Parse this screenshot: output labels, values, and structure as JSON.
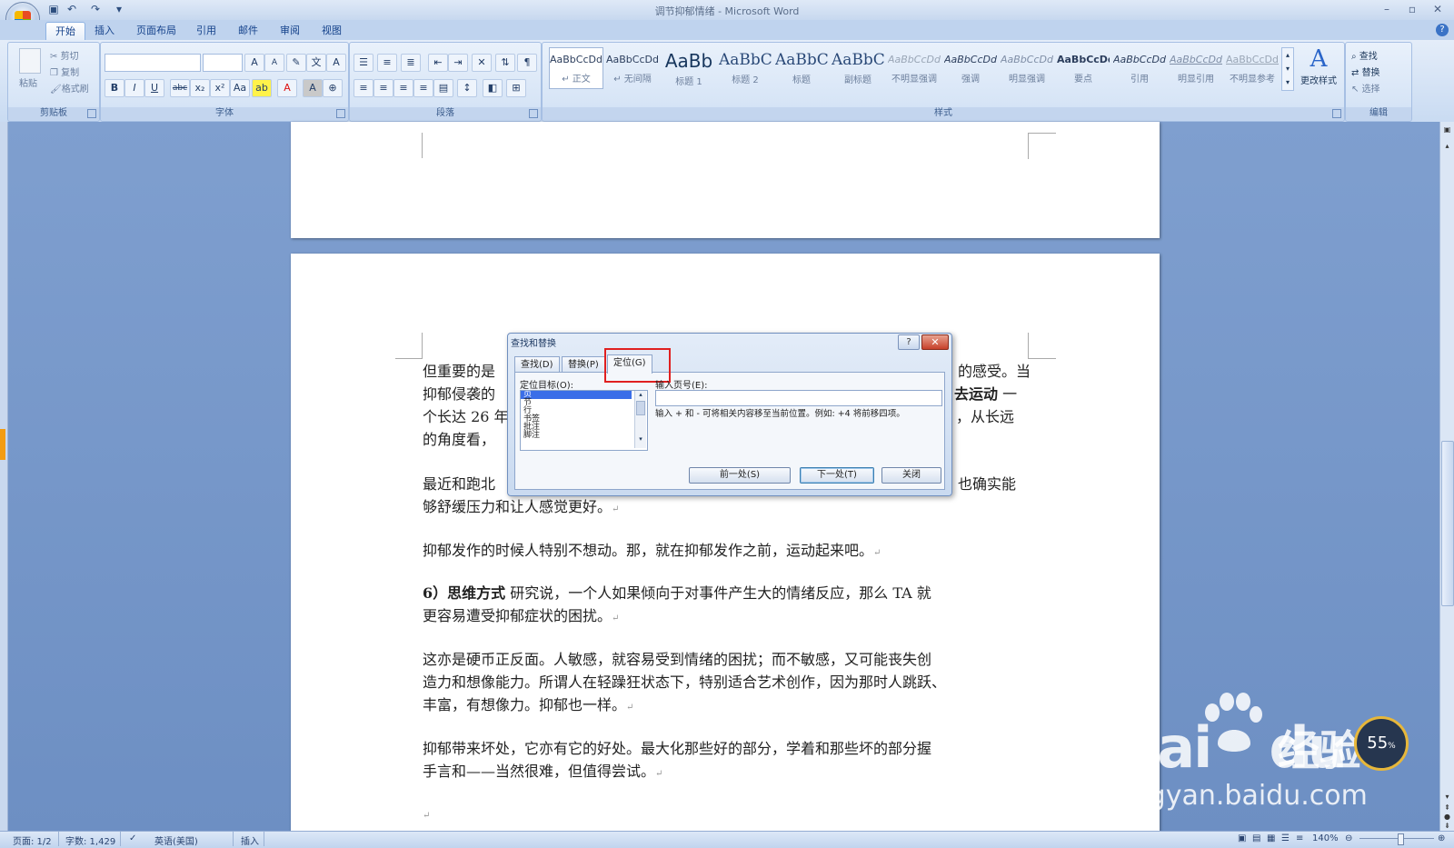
{
  "app": {
    "title": "调节抑郁情绪 - Microsoft Word"
  },
  "tabs": [
    "开始",
    "插入",
    "页面布局",
    "引用",
    "邮件",
    "审阅",
    "视图"
  ],
  "clipboard": {
    "paste": "粘贴",
    "cut": "剪切",
    "copy": "复制",
    "format_painter": "格式刷",
    "group": "剪贴板"
  },
  "font": {
    "group": "字体",
    "bold": "B",
    "italic": "I",
    "underline": "U",
    "strike": "abc",
    "sub": "x₂",
    "sup": "x²",
    "case": "Aa",
    "grow": "A",
    "shrink": "A",
    "color_a": "A",
    "char_border": "A"
  },
  "paragraph": {
    "group": "段落"
  },
  "styles": {
    "group": "样式",
    "items": [
      {
        "sample": "AaBbCcDd",
        "name": "↵ 正文"
      },
      {
        "sample": "AaBbCcDd",
        "name": "↵ 无间隔"
      },
      {
        "sample": "AaBb",
        "name": "标题 1"
      },
      {
        "sample": "AaBbC",
        "name": "标题 2"
      },
      {
        "sample": "AaBbC",
        "name": "标题"
      },
      {
        "sample": "AaBbC",
        "name": "副标题"
      },
      {
        "sample": "AaBbCcDd",
        "name": "不明显强调"
      },
      {
        "sample": "AaBbCcDd",
        "name": "强调"
      },
      {
        "sample": "AaBbCcDd",
        "name": "明显强调"
      },
      {
        "sample": "AaBbCcDd",
        "name": "要点"
      },
      {
        "sample": "AaBbCcDd",
        "name": "引用"
      },
      {
        "sample": "AaBbCcDd",
        "name": "明显引用"
      },
      {
        "sample": "AaBbCcDd",
        "name": "不明显参考"
      }
    ],
    "change": "更改样式"
  },
  "editing": {
    "group": "编辑",
    "find": "查找",
    "replace": "替换",
    "select": "选择"
  },
  "document": {
    "p1_l1": "但重要的是",
    "p1_l1_end": "的感受。当",
    "p1_l2": "抑郁侵袭的",
    "p1_l2_bold": "去运动",
    "p1_l2_end": "一",
    "p1_l3": "个长达 26 年",
    "p1_l3_end": "，从长远",
    "p1_l4": "的角度看，",
    "p2_l1": "最近和跑北",
    "p2_l1_end": "也确实能",
    "p2_l2": "够舒缓压力和让人感觉更好。",
    "p3": "抑郁发作的时候人特别不想动。那，就在抑郁发作之前，运动起来吧。",
    "p4_bold": "6）思维方式",
    "p4_rest": " 研究说，一个人如果倾向于对事件产生大的情绪反应，那么 TA 就",
    "p4_l2": "更容易遭受抑郁症状的困扰。",
    "p5_l1": "这亦是硬币正反面。人敏感，就容易受到情绪的困扰；而不敏感，又可能丧失创",
    "p5_l2": "造力和想像能力。所谓人在轻躁狂状态下，特别适合艺术创作，因为那时人跳跃、",
    "p5_l3": "丰富，有想像力。抑郁也一样。",
    "p6_l1": "抑郁带来坏处，它亦有它的好处。最大化那些好的部分，学着和那些坏的部分握",
    "p6_l2": "手言和——当然很难，但值得尝试。",
    "para_mark": "↵"
  },
  "dialog": {
    "title": "查找和替换",
    "help": "?",
    "close": "✕",
    "tabs": [
      "查找(D)",
      "替换(P)",
      "定位(G)"
    ],
    "active_tab": 2,
    "goto_label": "定位目标(O):",
    "goto_items": [
      "页",
      "节",
      "行",
      "书签",
      "批注",
      "脚注"
    ],
    "pageno_label": "输入页号(E):",
    "pageno_value": "",
    "hint": "输入 + 和 - 可将相关内容移至当前位置。例如: +4 将前移四项。",
    "prev": "前一处(S)",
    "next": "下一处(T)",
    "close_btn": "关闭"
  },
  "status": {
    "page": "页面: 1/2",
    "words": "字数: 1,429",
    "lang": "英语(美国)",
    "mode": "插入",
    "zoom": "140%"
  },
  "watermark": {
    "brand": "Bai",
    "brand2": "du",
    "jingyan": "经验",
    "url": "jingyan.baidu.com",
    "badge": "55"
  }
}
